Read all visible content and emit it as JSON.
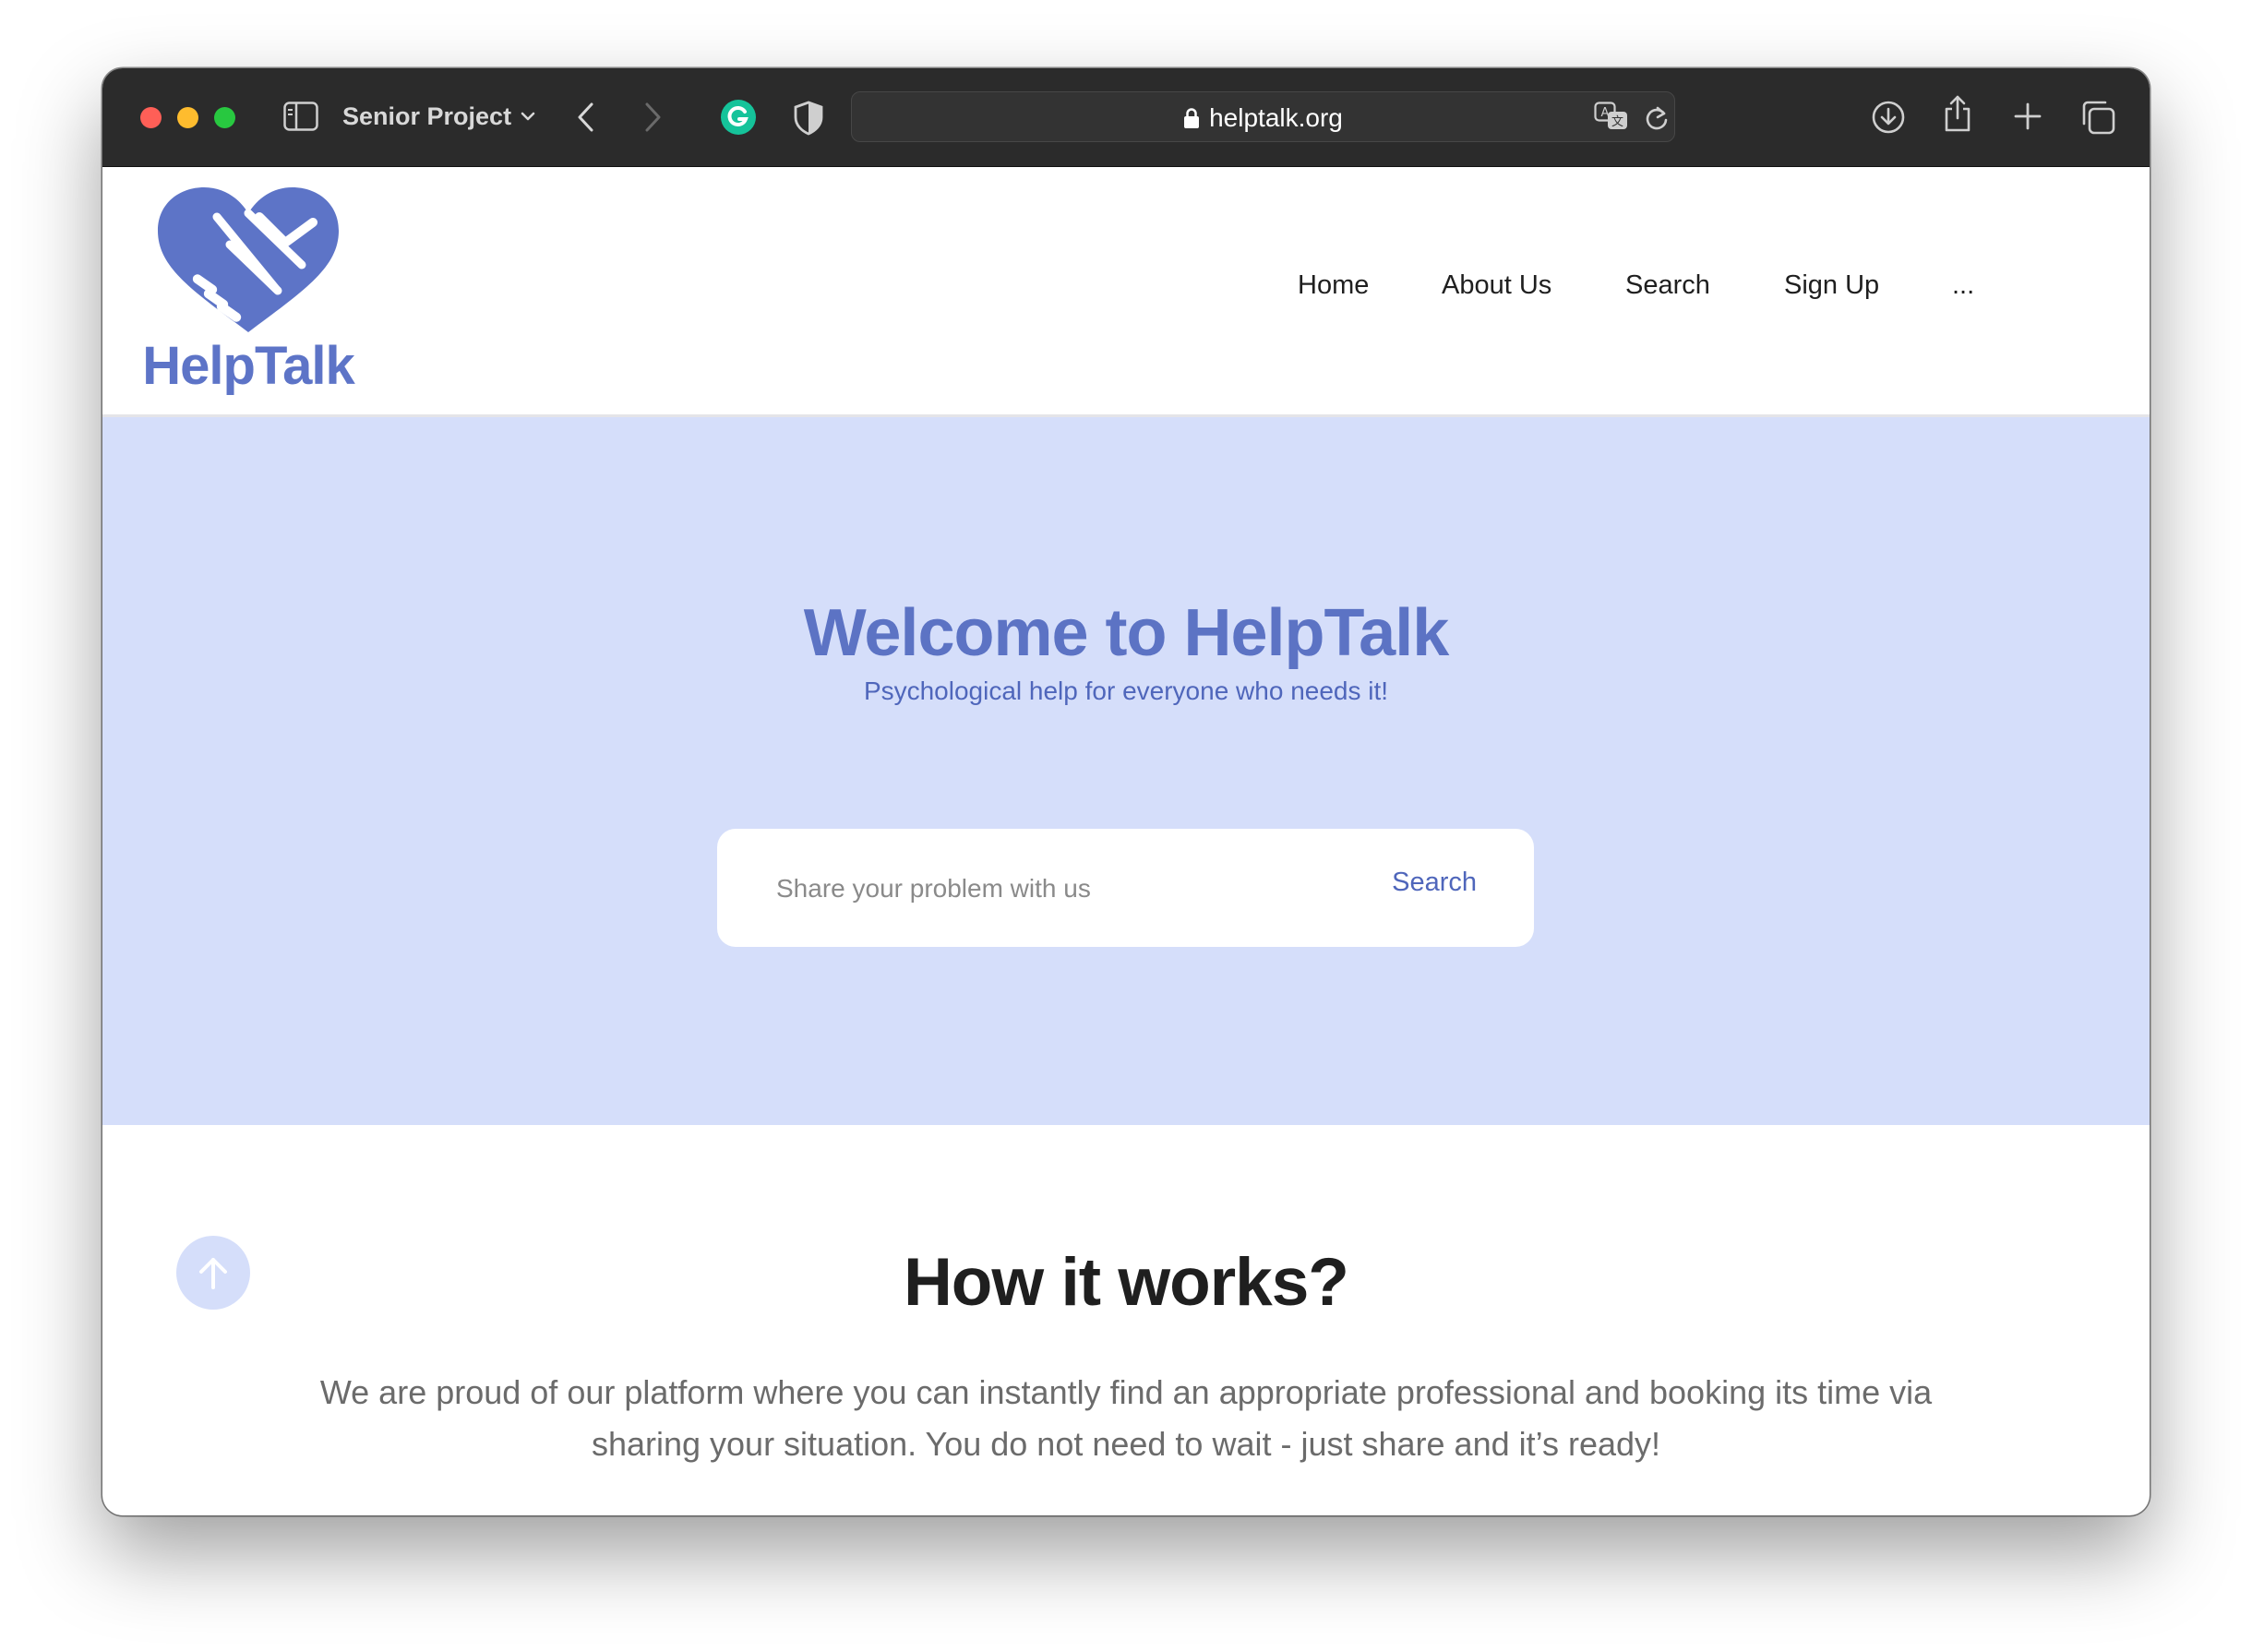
{
  "browser": {
    "tab_group_label": "Senior Project",
    "url": "helptalk.org",
    "icons": [
      "sidebar-icon",
      "chevron-down-icon",
      "back-icon",
      "forward-icon",
      "grammarly-icon",
      "shield-icon",
      "lock-icon",
      "translate-icon",
      "reload-icon",
      "download-icon",
      "share-icon",
      "plus-icon",
      "tabs-overview-icon"
    ]
  },
  "site": {
    "logo_text": "HelpTalk",
    "nav": [
      "Home",
      "About Us",
      "Search",
      "Sign Up",
      "..."
    ]
  },
  "hero": {
    "title": "Welcome to HelpTalk",
    "subtitle": "Psychological help for everyone who needs it!",
    "search_placeholder": "Share your problem with us",
    "search_button": "Search"
  },
  "how": {
    "title": "How it works?",
    "body": "We are proud of our platform where you can instantly find an appropriate professional and booking its time via sharing your situation. You do not need to wait - just share and it’s ready!"
  },
  "colors": {
    "brand": "#5d74c7",
    "hero_bg": "#d5defa",
    "toolbar_bg": "#2b2b2b"
  }
}
